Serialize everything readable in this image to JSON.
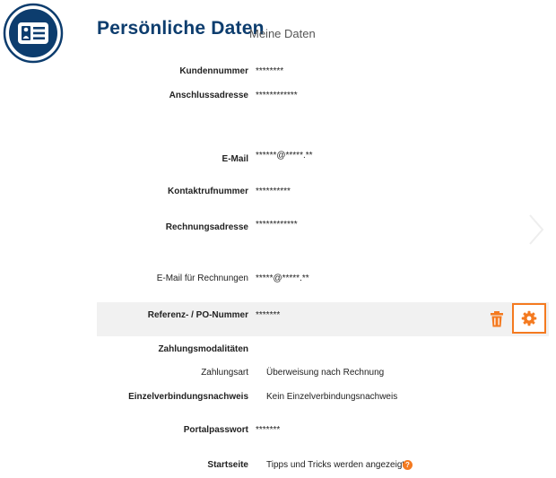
{
  "header": {
    "title": "Persönliche Daten",
    "subtitle": "Meine Daten",
    "logo_icon": "id-card-icon"
  },
  "fields": {
    "kundennummer": {
      "label": "Kundennummer",
      "value": "********"
    },
    "anschlussadresse": {
      "label": "Anschlussadresse",
      "value": "************"
    },
    "email": {
      "label": "E-Mail",
      "value": "******@*****.**"
    },
    "kontaktrufnummer": {
      "label": "Kontaktrufnummer",
      "value": "**********"
    },
    "rechnungsadresse": {
      "label": "Rechnungsadresse",
      "value": "************"
    },
    "email_rechnungen": {
      "label": "E-Mail für Rechnungen",
      "value": "*****@*****.**"
    },
    "referenz": {
      "label": "Referenz- / PO-Nummer",
      "value": "*******"
    },
    "zahlungsmodalitaeten": {
      "label": "Zahlungsmodalitäten"
    },
    "zahlungsart": {
      "label": "Zahlungsart",
      "value": "Überweisung nach Rechnung"
    },
    "einzelverbindungsnachweis": {
      "label": "Einzelverbindungsnachweis",
      "value": "Kein Einzelverbindungsnachweis"
    },
    "portalpasswort": {
      "label": "Portalpasswort",
      "value": "*******"
    },
    "startseite": {
      "label": "Startseite",
      "value": "Tipps und Tricks werden angezeigt",
      "help": "?"
    }
  },
  "colors": {
    "accent": "#f47a20",
    "brand": "#0d3d6e"
  }
}
